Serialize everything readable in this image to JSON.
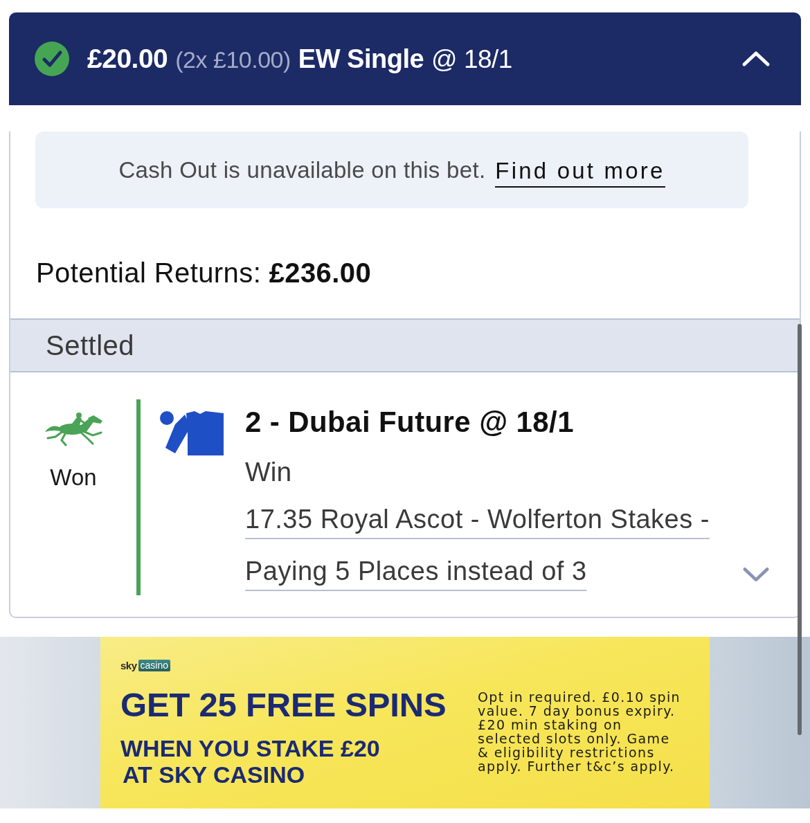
{
  "bet": {
    "expanded": true,
    "stake": "£20.00",
    "stake_breakdown": "(2x £10.00)",
    "bet_type": "EW Single",
    "odds": "@ 18/1"
  },
  "cash_out_notice": {
    "text": "Cash Out is unavailable on this bet.",
    "link": "Find out more"
  },
  "potential_returns": "Potential Returns: **£236.00**",
  "section_header": "Settled",
  "legs": [
    {
      "result": "Won",
      "color": "#4aa356",
      "expanded": false,
      "selection": "2 - Dubai Future @ 18/1",
      "market": "Win",
      "race": "17.35 Royal Ascot - Wolferton Stakes - Paying 5 Places instead of 3"
    }
  ],
  "banner": {
    "logo_word": "sky",
    "logo_badge": "casino",
    "headline": "GET 25 FREE SPINS",
    "subheadline_lines": [
      "WHEN YOU STAKE £20",
      "AT SKY CASINO"
    ],
    "terms": "Opt in required. £0.10 spin value. 7 day bonus expiry. £20 min staking on selected slots only. Game & eligibility restrictions apply. Further t&c’s apply."
  }
}
